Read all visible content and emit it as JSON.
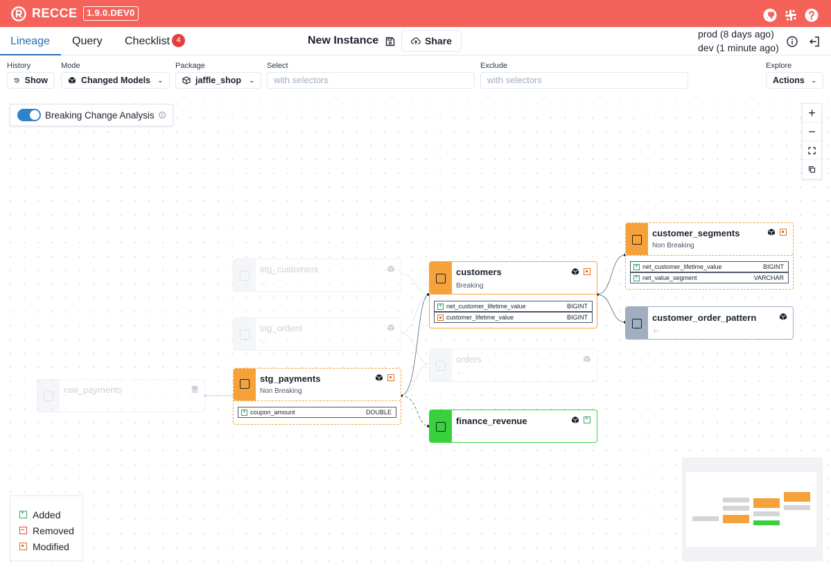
{
  "app": {
    "name": "RECCE",
    "version": "1.9.0.DEV0"
  },
  "tabs": [
    {
      "label": "Lineage"
    },
    {
      "label": "Query"
    },
    {
      "label": "Checklist",
      "badge": "4"
    }
  ],
  "instance": {
    "title": "New Instance",
    "share_label": "Share"
  },
  "env": {
    "prod": "prod (8 days ago)",
    "dev": "dev (1 minute ago)"
  },
  "toolbar": {
    "history_label": "History",
    "history_btn": "Show",
    "mode_label": "Mode",
    "mode_value": "Changed Models",
    "package_label": "Package",
    "package_value": "jaffle_shop",
    "select_label": "Select",
    "select_placeholder": "with selectors",
    "exclude_label": "Exclude",
    "exclude_placeholder": "with selectors",
    "explore_label": "Explore",
    "actions_btn": "Actions"
  },
  "breaking_change": {
    "label": "Breaking Change Analysis",
    "enabled": true
  },
  "nodes": {
    "raw_payments": {
      "name": "raw_payments"
    },
    "stg_customers": {
      "name": "stg_customers"
    },
    "stg_orders": {
      "name": "stg_orders"
    },
    "stg_payments": {
      "name": "stg_payments",
      "status": "Non Breaking",
      "columns": [
        {
          "name": "coupon_amount",
          "type": "DOUBLE",
          "change": "added"
        }
      ]
    },
    "customers": {
      "name": "customers",
      "status": "Breaking",
      "columns": [
        {
          "name": "net_customer_lifetime_value",
          "type": "BIGINT",
          "change": "added"
        },
        {
          "name": "customer_lifetime_value",
          "type": "BIGINT",
          "change": "modified"
        }
      ]
    },
    "orders": {
      "name": "orders"
    },
    "finance_revenue": {
      "name": "finance_revenue"
    },
    "customer_segments": {
      "name": "customer_segments",
      "status": "Non Breaking",
      "columns": [
        {
          "name": "net_customer_lifetime_value",
          "type": "BIGINT",
          "change": "added"
        },
        {
          "name": "net_value_segment",
          "type": "VARCHAR",
          "change": "added"
        }
      ]
    },
    "customer_order_pattern": {
      "name": "customer_order_pattern"
    }
  },
  "legend": {
    "added": "Added",
    "removed": "Removed",
    "modified": "Modified"
  },
  "colors": {
    "brand": "#f5625a",
    "modified": "#f6a23b",
    "added": "#38d13c",
    "unchanged": "#a0aec0",
    "active_tab": "#2b6cb0"
  }
}
